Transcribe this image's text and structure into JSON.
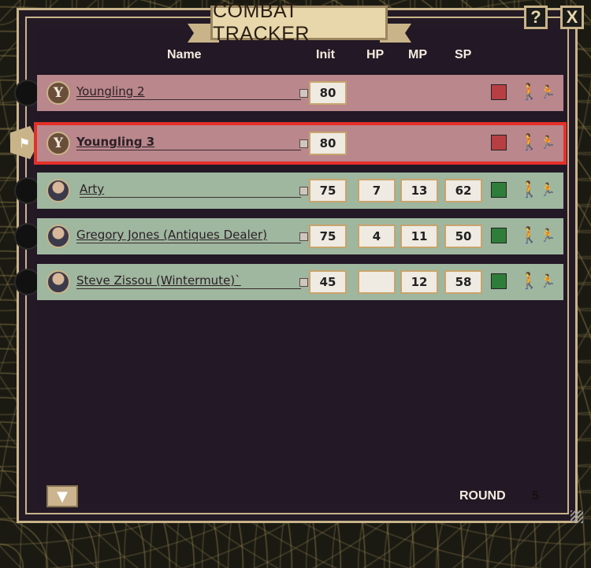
{
  "window": {
    "title": "COMBAT TRACKER",
    "help_label": "?",
    "close_label": "X"
  },
  "columns": {
    "name": "Name",
    "init": "Init",
    "hp": "HP",
    "mp": "MP",
    "sp": "SP"
  },
  "rows": [
    {
      "name": "Youngling 2",
      "init": "80",
      "hp": "",
      "mp": "",
      "sp": "",
      "faction": "hostile",
      "avatar": "Y",
      "active": false
    },
    {
      "name": "Youngling 3",
      "init": "80",
      "hp": "",
      "mp": "",
      "sp": "",
      "faction": "hostile",
      "avatar": "Y",
      "active": true
    },
    {
      "name": "Arty",
      "init": "75",
      "hp": "7",
      "mp": "13",
      "sp": "62",
      "faction": "friendly",
      "avatar": "",
      "active": false
    },
    {
      "name": "Gregory Jones (Antiques Dealer)",
      "init": "75",
      "hp": "4",
      "mp": "11",
      "sp": "50",
      "faction": "friendly",
      "avatar": "",
      "active": false
    },
    {
      "name": "Steve Zissou (Wintermute)`",
      "init": "45",
      "hp": "",
      "mp": "12",
      "sp": "58",
      "faction": "friendly",
      "avatar": "",
      "active": false
    }
  ],
  "footer": {
    "round_label": "ROUND",
    "round_value": "5",
    "down_icon": "triangle-down-icon"
  },
  "icons": {
    "move": "walking-figure-icon",
    "action": "running-figures-icon",
    "turn_flag": "flag-icon"
  },
  "colors": {
    "hostile_row": "#b9878c",
    "friendly_row": "#9fb69f",
    "active_outline": "#e5302a",
    "frame_gold": "#c9b48a"
  }
}
